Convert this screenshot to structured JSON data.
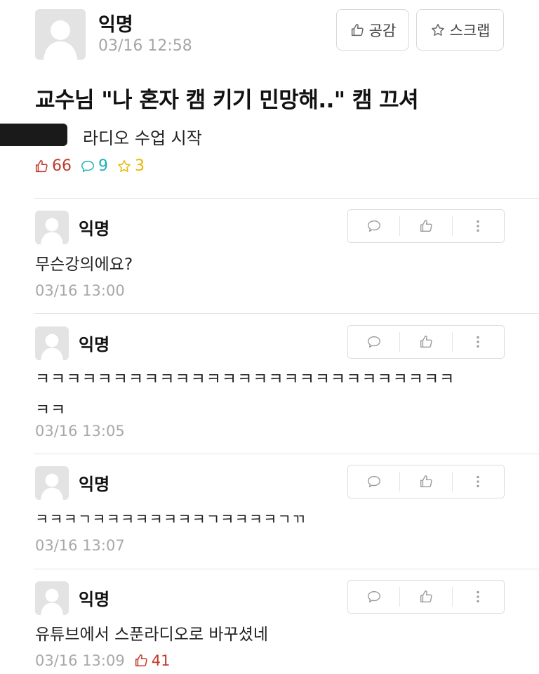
{
  "post": {
    "author": "익명",
    "time": "03/16 12:58",
    "like_button": "공감",
    "scrap_button": "스크랩",
    "title": "교수님 \"나 혼자 캠 키기 민망해..\" 캠 끄셔",
    "body": "라디오 수업 시작",
    "stats": {
      "likes": "66",
      "comments": "9",
      "scraps": "3"
    }
  },
  "comments": [
    {
      "author": "익명",
      "text_line1": "무슨강의에요?",
      "text_line2": "",
      "time": "03/16 13:00",
      "likes": ""
    },
    {
      "author": "익명",
      "text_line1": "ㅋㅋㅋㅋㅋㅋㅋㅋㅋㅋㅋㅋㅋㅋㅋㅋㅋㅋㅋㅋㅋㅋㅋㅋㅋㅋㅋ",
      "text_line2": "ㅋㅋ",
      "time": "03/16 13:05",
      "likes": ""
    },
    {
      "author": "익명",
      "text_line1": "ㅋㅋㅋㄱㅋㅋㅋㅋㅋㅋㅋㅋㄱㅋㅋㅋㅋㄱㄲ",
      "text_line2": "",
      "time": "03/16 13:07",
      "likes": ""
    },
    {
      "author": "익명",
      "text_line1": "유튜브에서 스푼라디오로 바꾸셨네",
      "text_line2": "",
      "time": "03/16 13:09",
      "likes": "41"
    }
  ],
  "colors": {
    "like": "#c0392b",
    "comment": "#1ab0b8",
    "scrap": "#e6b800",
    "muted": "#a6a6a6"
  },
  "icons": [
    "avatar-placeholder-icon",
    "thumbs-up-icon",
    "star-icon",
    "speech-bubble-icon",
    "more-vertical-icon"
  ]
}
